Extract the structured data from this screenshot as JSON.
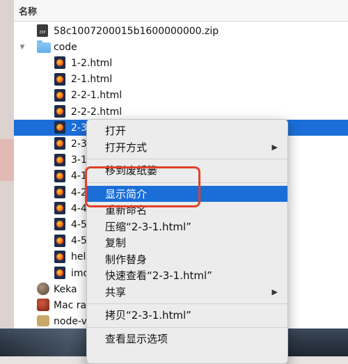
{
  "column_header": {
    "name_label": "名称"
  },
  "files": [
    {
      "name": "58c1007200015b1600000000.zip",
      "icon": "zip-file-icon",
      "indent": 1
    },
    {
      "name": "code",
      "icon": "folder-icon",
      "indent": 1,
      "expanded": true
    },
    {
      "name": "1-2.html",
      "icon": "html-file-icon",
      "indent": 2
    },
    {
      "name": "2-1.html",
      "icon": "html-file-icon",
      "indent": 2
    },
    {
      "name": "2-2-1.html",
      "icon": "html-file-icon",
      "indent": 2
    },
    {
      "name": "2-2-2.html",
      "icon": "html-file-icon",
      "indent": 2
    },
    {
      "name": "2-3",
      "icon": "html-file-icon",
      "indent": 2,
      "selected": true
    },
    {
      "name": "2-3",
      "icon": "html-file-icon",
      "indent": 2
    },
    {
      "name": "3-1",
      "icon": "html-file-icon",
      "indent": 2
    },
    {
      "name": "4-1",
      "icon": "html-file-icon",
      "indent": 2
    },
    {
      "name": "4-2",
      "icon": "html-file-icon",
      "indent": 2
    },
    {
      "name": "4-4",
      "icon": "html-file-icon",
      "indent": 2
    },
    {
      "name": "4-5",
      "icon": "html-file-icon",
      "indent": 2
    },
    {
      "name": "4-5",
      "icon": "html-file-icon",
      "indent": 2
    },
    {
      "name": "hel",
      "icon": "html-file-icon",
      "indent": 2
    },
    {
      "name": "imo",
      "icon": "html-file-icon",
      "indent": 2
    },
    {
      "name": "Keka",
      "icon": "app-icon",
      "indent": 1
    },
    {
      "name": "Mac ra",
      "icon": "app-icon",
      "indent": 1
    },
    {
      "name": "node-v",
      "icon": "package-icon",
      "indent": 1
    }
  ],
  "context_menu": {
    "items": [
      {
        "label": "打开"
      },
      {
        "label": "打开方式",
        "submenu": true
      },
      {
        "label": "移到废纸篓",
        "sep_before": true
      },
      {
        "label": "显示简介",
        "sep_before": true,
        "highlighted": true
      },
      {
        "label": "重新命名"
      },
      {
        "label": "压缩“2-3-1.html”"
      },
      {
        "label": "复制"
      },
      {
        "label": "制作替身"
      },
      {
        "label": "快速查看“2-3-1.html”"
      },
      {
        "label": "共享",
        "submenu": true
      },
      {
        "label": "拷贝“2-3-1.html”",
        "sep_before": true
      },
      {
        "label": "查看显示选项",
        "sep_before": true
      }
    ],
    "submenu_arrow": "▶"
  },
  "colors": {
    "selection": "#1b6ed8",
    "annotation": "#e2402a"
  }
}
